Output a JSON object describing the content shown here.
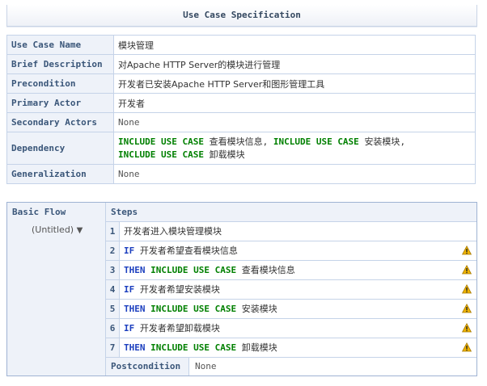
{
  "header": {
    "title": "Use Case Specification"
  },
  "spec": {
    "use_case_name": {
      "label": "Use Case Name",
      "value": "模块管理"
    },
    "brief_description": {
      "label": "Brief Description",
      "value": "对Apache HTTP Server的模块进行管理"
    },
    "precondition": {
      "label": "Precondition",
      "value": "开发者已安装Apache HTTP Server和图形管理工具"
    },
    "primary_actor": {
      "label": "Primary Actor",
      "value": "开发者"
    },
    "secondary_actors": {
      "label": "Secondary Actors",
      "value": "None"
    },
    "dependency": {
      "label": "Dependency",
      "kw": "INCLUDE USE CASE",
      "item1": "查看模块信息",
      "sep": ",",
      "item2": "安装模块",
      "item3": "卸载模块"
    },
    "generalization": {
      "label": "Generalization",
      "value": "None"
    }
  },
  "flow": {
    "label": "Basic Flow",
    "untitled": "(Untitled)",
    "steps_header": "Steps",
    "steps": [
      {
        "num": "1",
        "kw1": "",
        "kw2": "",
        "text": "开发者进入模块管理模块",
        "warn": false
      },
      {
        "num": "2",
        "kw1": "IF",
        "kw2": "",
        "text": "开发者希望查看模块信息",
        "warn": true
      },
      {
        "num": "3",
        "kw1": "THEN",
        "kw2": "INCLUDE USE CASE",
        "text": "查看模块信息",
        "warn": true
      },
      {
        "num": "4",
        "kw1": "IF",
        "kw2": "",
        "text": "开发者希望安装模块",
        "warn": true
      },
      {
        "num": "5",
        "kw1": "THEN",
        "kw2": "INCLUDE USE CASE",
        "text": "安装模块",
        "warn": true
      },
      {
        "num": "6",
        "kw1": "IF",
        "kw2": "",
        "text": "开发者希望卸载模块",
        "warn": true
      },
      {
        "num": "7",
        "kw1": "THEN",
        "kw2": "INCLUDE USE CASE",
        "text": "卸载模块",
        "warn": true
      }
    ],
    "postcondition": {
      "label": "Postcondition",
      "value": "None"
    }
  },
  "colors": {
    "keyword_green": "#008000",
    "keyword_blue": "#1c3fbf",
    "label_text": "#3a5679",
    "warning": "#f0b400"
  }
}
